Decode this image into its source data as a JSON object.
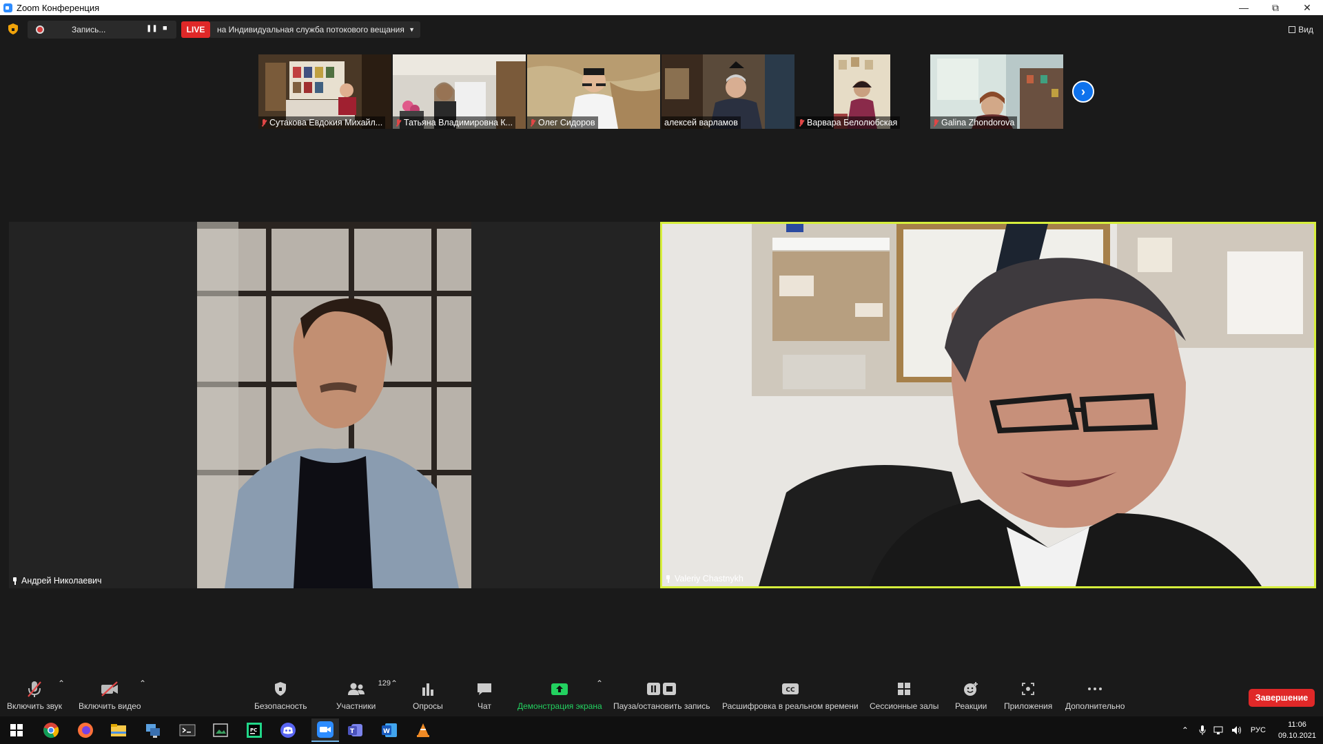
{
  "window": {
    "title": "Zoom Конференция",
    "icon": "zoom-logo"
  },
  "recording": {
    "label": "Запись..."
  },
  "livestream": {
    "badge": "LIVE",
    "target": "на Индивидуальная служба потокового вещания"
  },
  "view_button": {
    "label": "Вид"
  },
  "gallery_strip": [
    {
      "name": "Сутакова Евдокия Михайл...",
      "muted": true
    },
    {
      "name": "Татьяна Владимировна К...",
      "muted": true
    },
    {
      "name": "Олег Сидоров",
      "muted": true
    },
    {
      "name": "алексей варламов",
      "muted": false
    },
    {
      "name": "Варвара Белолюбская",
      "muted": true
    },
    {
      "name": "Galina Zhondorova",
      "muted": true
    }
  ],
  "main_videos": [
    {
      "name": "Андрей Николаевич",
      "pinned": true,
      "active_speaker": false
    },
    {
      "name": "Valeriy Chastnykh",
      "pinned": true,
      "active_speaker": true
    }
  ],
  "toolbar": {
    "unmute": "Включить звук",
    "start_video": "Включить видео",
    "security": "Безопасность",
    "participants": "Участники",
    "participants_count": "129",
    "polls": "Опросы",
    "chat": "Чат",
    "share_screen": "Демонстрация экрана",
    "pause_stop_recording": "Пауза/остановить запись",
    "live_transcript": "Расшифровка в реальном времени",
    "breakout_rooms": "Сессионные залы",
    "reactions": "Реакции",
    "apps": "Приложения",
    "more": "Дополнительно",
    "end": "Завершение"
  },
  "taskbar": {
    "language": "РУС",
    "time": "11:06",
    "date": "09.10.2021",
    "apps": [
      "windows-start-icon",
      "chrome-icon",
      "firefox-icon",
      "file-explorer-icon",
      "network-icon",
      "terminal-icon",
      "screenshot-icon",
      "pycharm-icon",
      "discord-icon",
      "zoom-icon",
      "teams-icon",
      "word-icon",
      "vlc-icon"
    ]
  },
  "colors": {
    "accent": "#0e72ed",
    "live": "#e02828",
    "active_speaker_border": "#d6ee3c",
    "share_green": "#23d160",
    "background": "#1a1a1a"
  }
}
